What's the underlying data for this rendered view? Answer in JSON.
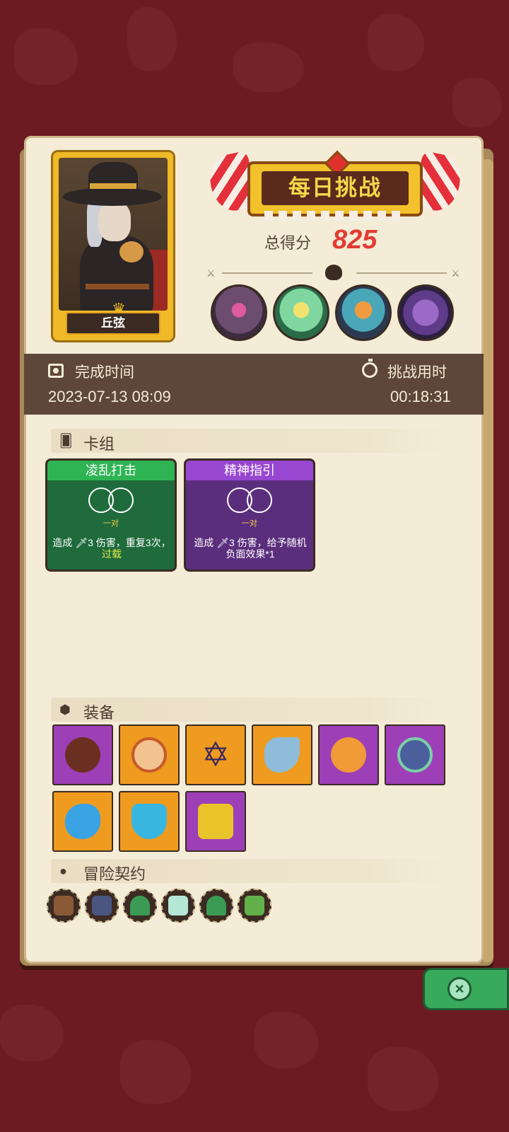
{
  "hero": {
    "name": "丘弦"
  },
  "header": {
    "title": "每日挑战",
    "score_label": "总得分",
    "score_value": "825"
  },
  "info": {
    "completion_label": "完成时间",
    "completion_value": "2023-07-13 08:09",
    "duration_label": "挑战用时",
    "duration_value": "00:18:31"
  },
  "deck": {
    "title": "卡组",
    "cards": [
      {
        "name": "凌乱打击",
        "pair": "一对",
        "desc_pre": "造成 ",
        "damage": "3",
        "desc_mid": " 伤害，重复3次，",
        "keyword": "过载",
        "color": "green"
      },
      {
        "name": "精神指引",
        "pair": "一对",
        "desc_pre": "造成 ",
        "damage": "3",
        "desc_mid": " 伤害，给予随机负面效果*1",
        "keyword": "",
        "color": "purple"
      }
    ]
  },
  "equipment": {
    "title": "装备",
    "items": [
      {
        "icon": "button-icon",
        "color": "#9d3fb7"
      },
      {
        "icon": "ring-plate-icon",
        "color": "#ef9b1f"
      },
      {
        "icon": "hexagram-icon",
        "color": "#ef9b1f"
      },
      {
        "icon": "horn-icon",
        "color": "#ef9b1f"
      },
      {
        "icon": "cheese-icon",
        "color": "#9d3fb7"
      },
      {
        "icon": "eye-ring-icon",
        "color": "#9d3fb7"
      },
      {
        "icon": "blue-blob-icon",
        "color": "#ef9b1f"
      },
      {
        "icon": "shield-gem-icon",
        "color": "#ef9b1f"
      },
      {
        "icon": "treasure-chest-icon",
        "color": "#9d3fb7"
      }
    ]
  },
  "contracts": {
    "title": "冒险契约",
    "items": [
      "chest-contract-icon",
      "mystery-card-icon",
      "star-triangle-icon",
      "potion-icon",
      "star-triangle-icon",
      "poison-bottle-icon"
    ]
  },
  "colors": {
    "accent_red": "#e23b33",
    "panel": "#f4ecd6",
    "bar": "#5e4638"
  }
}
